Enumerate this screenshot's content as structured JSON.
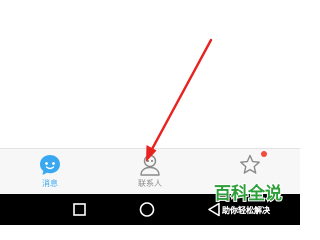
{
  "tabs": [
    {
      "label": "消息",
      "icon": "chat-bubble-icon",
      "active": true,
      "color": "#3aa8f0"
    },
    {
      "label": "联系人",
      "icon": "contact-person-icon",
      "active": false,
      "color": "#888888"
    },
    {
      "label": "",
      "icon": "star-icon",
      "active": false,
      "color": "#888888",
      "badge": "red-dot"
    }
  ],
  "colors": {
    "active_tab": "#3aa8f0",
    "inactive_tab": "#8a8a8a",
    "badge": "#f04b3c",
    "arrow": "#e8231f",
    "watermark_green": "#2e9e3a",
    "nav_background": "#000000"
  },
  "system_nav": {
    "back_icon": "square-icon",
    "home_icon": "circle-icon",
    "recent_icon": "triangle-back-icon"
  },
  "watermark": {
    "title": "百科全说",
    "subtitle": "助你轻松解决"
  }
}
